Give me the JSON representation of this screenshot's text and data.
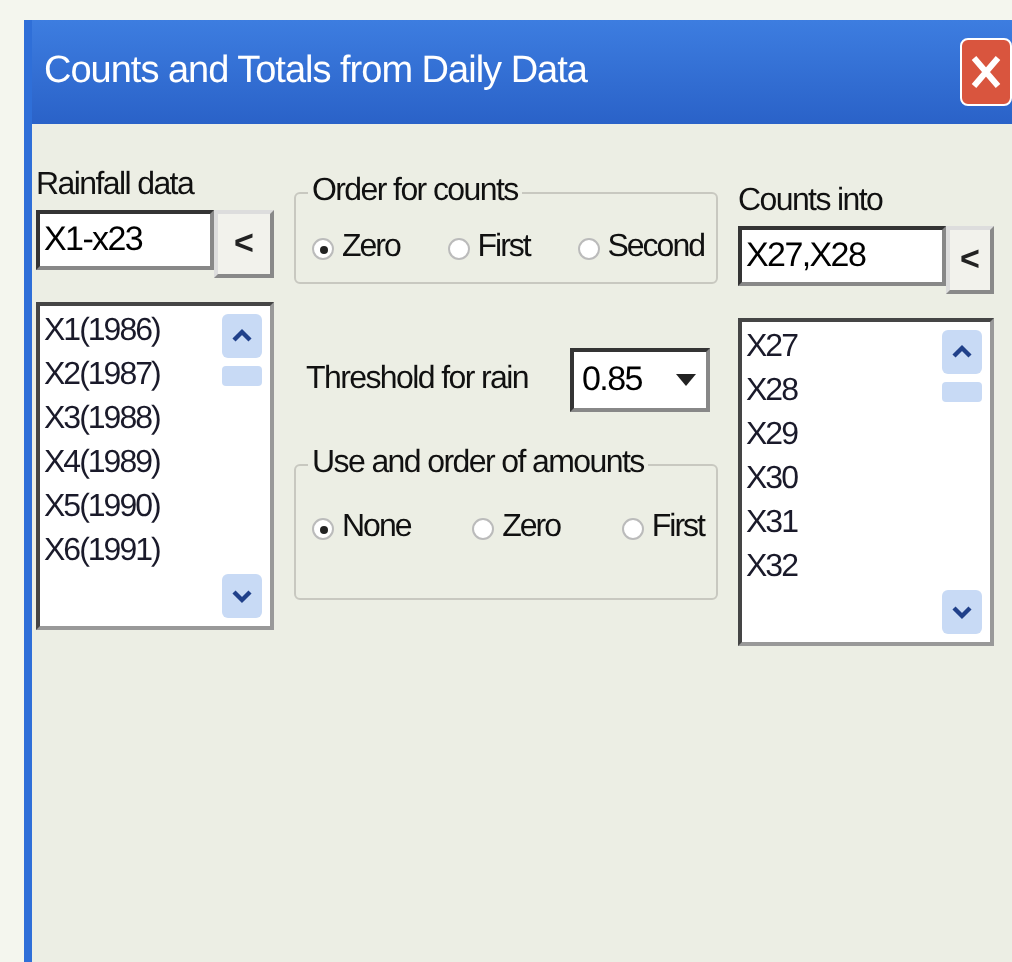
{
  "window": {
    "title": "Counts and Totals from Daily Data"
  },
  "rainfall_data": {
    "label": "Rainfall data",
    "value": "X1-x23",
    "button": "<",
    "items": [
      "X1(1986)",
      "X2(1987)",
      "X3(1988)",
      "X4(1989)",
      "X5(1990)",
      "X6(1991)"
    ]
  },
  "order_for_counts": {
    "label": "Order for counts",
    "options": [
      {
        "label": "Zero",
        "selected": true
      },
      {
        "label": "First",
        "selected": false
      },
      {
        "label": "Second",
        "selected": false
      }
    ]
  },
  "threshold": {
    "label": "Threshold for rain",
    "value": "0.85"
  },
  "use_and_order_of_amounts": {
    "label": "Use and order of amounts",
    "options": [
      {
        "label": "None",
        "selected": true
      },
      {
        "label": "Zero",
        "selected": false
      },
      {
        "label": "First",
        "selected": false
      }
    ]
  },
  "counts_into": {
    "label": "Counts into",
    "value": "X27,X28",
    "button": "<",
    "items": [
      "X27",
      "X28",
      "X29",
      "X30",
      "X31",
      "X32"
    ]
  }
}
